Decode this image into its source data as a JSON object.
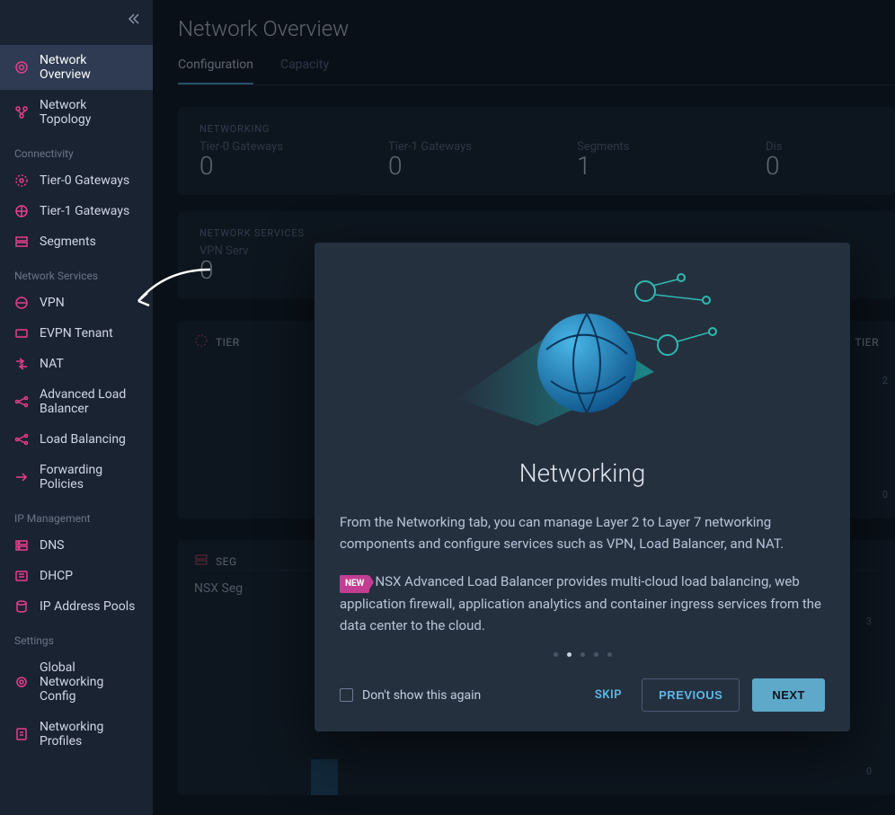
{
  "sidebar": {
    "top": [
      {
        "id": "network-overview",
        "label": "Network Overview",
        "active": true
      },
      {
        "id": "network-topology",
        "label": "Network Topology"
      }
    ],
    "groups": [
      {
        "title": "Connectivity",
        "items": [
          {
            "id": "tier0-gateways",
            "label": "Tier-0 Gateways"
          },
          {
            "id": "tier1-gateways",
            "label": "Tier-1 Gateways"
          },
          {
            "id": "segments",
            "label": "Segments"
          }
        ]
      },
      {
        "title": "Network Services",
        "items": [
          {
            "id": "vpn",
            "label": "VPN"
          },
          {
            "id": "evpn-tenant",
            "label": "EVPN Tenant"
          },
          {
            "id": "nat",
            "label": "NAT"
          },
          {
            "id": "adv-lb",
            "label": "Advanced Load Balancer"
          },
          {
            "id": "lb",
            "label": "Load Balancing"
          },
          {
            "id": "forwarding-policies",
            "label": "Forwarding Policies"
          }
        ]
      },
      {
        "title": "IP Management",
        "items": [
          {
            "id": "dns",
            "label": "DNS"
          },
          {
            "id": "dhcp",
            "label": "DHCP"
          },
          {
            "id": "ip-pools",
            "label": "IP Address Pools"
          }
        ]
      },
      {
        "title": "Settings",
        "items": [
          {
            "id": "global-net-config",
            "label": "Global Networking Config"
          },
          {
            "id": "networking-profiles",
            "label": "Networking Profiles"
          }
        ]
      }
    ]
  },
  "page": {
    "title": "Network Overview",
    "tabs": [
      {
        "id": "configuration",
        "label": "Configuration",
        "active": true
      },
      {
        "id": "capacity",
        "label": "Capacity"
      }
    ],
    "cards": {
      "networking": {
        "label": "NETWORKING",
        "stats": [
          {
            "label": "Tier-0 Gateways",
            "value": "0"
          },
          {
            "label": "Tier-1 Gateways",
            "value": "0"
          },
          {
            "label": "Segments",
            "value": "1"
          },
          {
            "label": "Dis",
            "value": "0"
          }
        ]
      },
      "netservices": {
        "label": "NETWORK SERVICES",
        "stats": [
          {
            "label": "VPN Serv",
            "value": "0"
          }
        ]
      }
    },
    "charts": {
      "left": {
        "title": "TIER",
        "marks": []
      },
      "right": {
        "title": "TIER",
        "marks": [
          "2",
          "0"
        ]
      }
    },
    "segcard": {
      "label": "SEG",
      "row": "NSX Seg",
      "marks": [
        "3",
        "0"
      ]
    }
  },
  "modal": {
    "title": "Networking",
    "p1": "From the Networking tab, you can manage Layer 2 to Layer 7 networking components and configure services such as VPN, Load Balancer, and NAT.",
    "new": "NEW",
    "p2": "NSX Advanced Load Balancer provides multi-cloud load balancing, web application firewall, application analytics and container ingress services from the data center to the cloud.",
    "dont_show": "Don't show this again",
    "skip": "SKIP",
    "previous": "PREVIOUS",
    "next": "NEXT",
    "dots": 5,
    "active_dot": 1
  }
}
